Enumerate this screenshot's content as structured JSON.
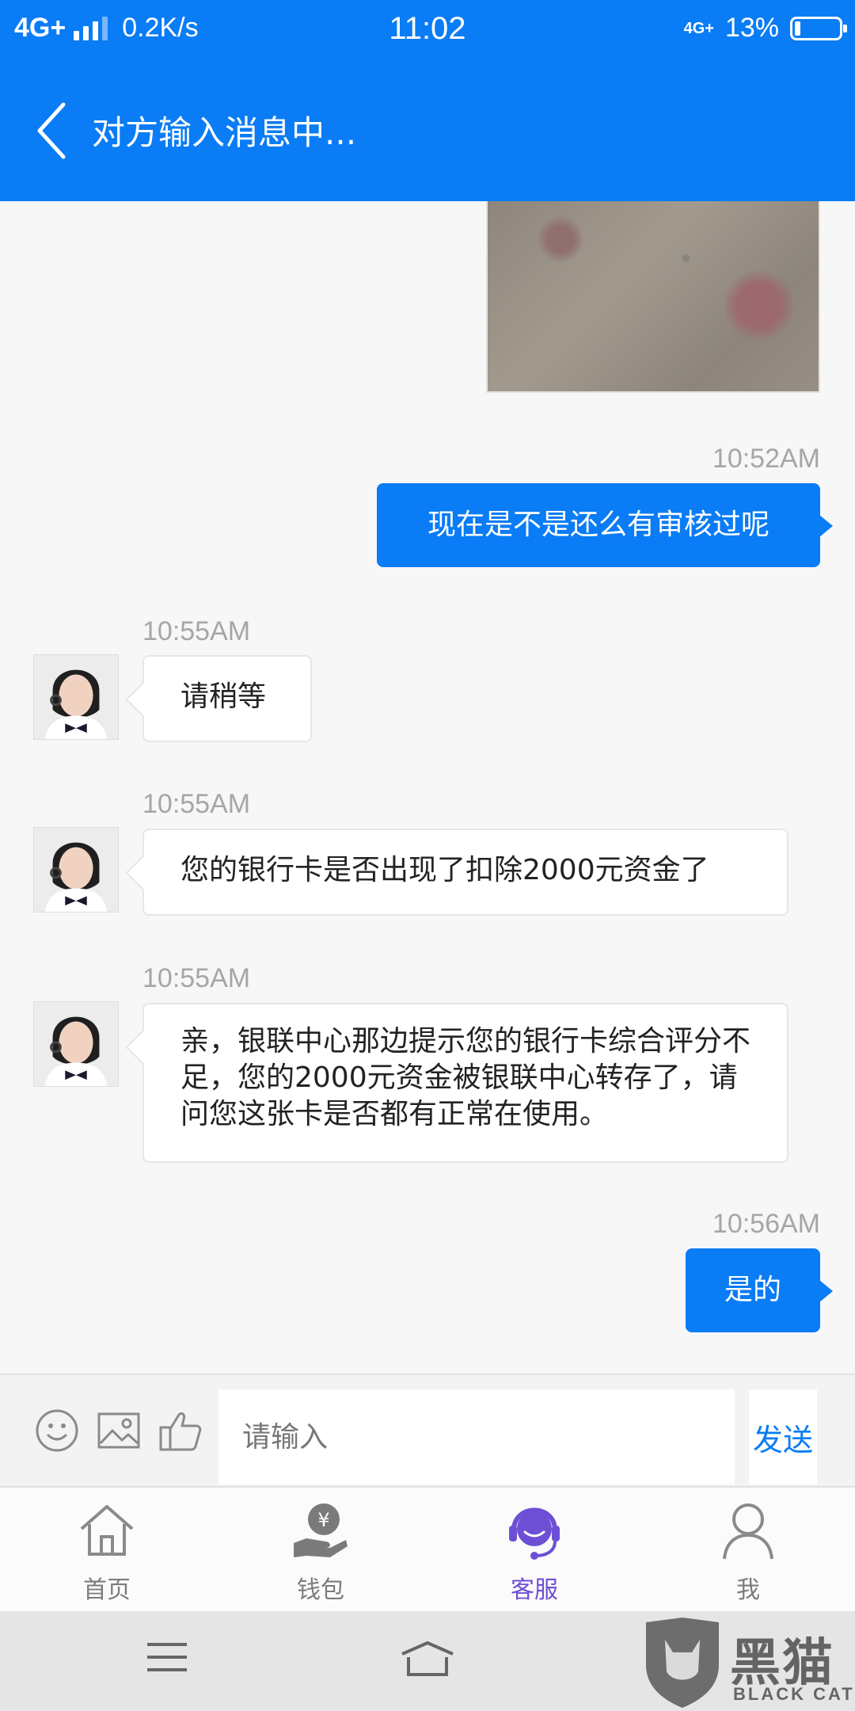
{
  "status_bar": {
    "network": "4G+",
    "speed": "0.2K/s",
    "time": "11:02",
    "secondary_network": "4G+",
    "battery": "13%",
    "battery_level": 0.13
  },
  "header": {
    "back_icon": "chevron-left-icon",
    "title": "对方输入消息中..."
  },
  "messages": [
    {
      "type": "image",
      "side": "out",
      "icon": "photo-thumbnail"
    },
    {
      "side": "out",
      "time": "10:52AM",
      "text": "现在是不是还么有审核过呢"
    },
    {
      "side": "in",
      "time": "10:55AM",
      "text": "请稍等"
    },
    {
      "side": "in",
      "time": "10:55AM",
      "text": "您的银行卡是否出现了扣除2000元资金了"
    },
    {
      "side": "in",
      "time": "10:55AM",
      "text": "亲，银联中心那边提示您的银行卡综合评分不足，您的2000元资金被银联中心转存了，请问您这张卡是否都有正常在使用。"
    },
    {
      "side": "out",
      "time": "10:56AM",
      "text": "是的"
    }
  ],
  "input_bar": {
    "icons": [
      "emoji-icon",
      "image-icon",
      "thumbs-up-icon"
    ],
    "placeholder": "请输入",
    "send_label": "发送"
  },
  "tabs": [
    {
      "label": "首页",
      "icon": "home-icon",
      "active": false
    },
    {
      "label": "钱包",
      "icon": "wallet-icon",
      "active": false
    },
    {
      "label": "客服",
      "icon": "customer-service-icon",
      "active": true
    },
    {
      "label": "我",
      "icon": "user-icon",
      "active": false
    }
  ],
  "watermark": {
    "text": "黑猫",
    "subtext": "BLACK CAT"
  },
  "colors": {
    "accent": "#0a7cf5",
    "active_tab": "#6d4fd6",
    "timestamp": "#a6a6a6"
  }
}
